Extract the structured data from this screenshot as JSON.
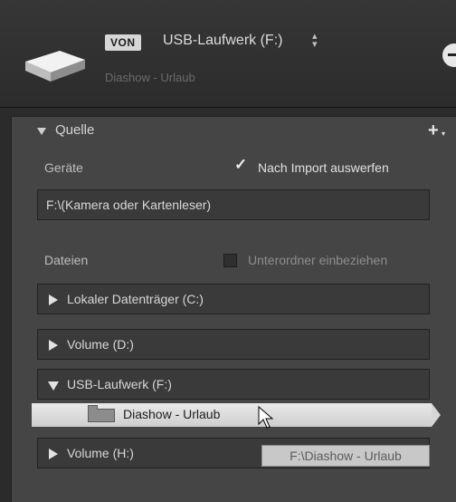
{
  "header": {
    "badge": "VON",
    "source_title": "USB-Laufwerk (F:)",
    "source_arrows": "⬍",
    "source_subtitle": "Diashow - Urlaub",
    "drive_icon": "hard-drive-icon"
  },
  "panel": {
    "title": "Quelle",
    "add_button": "+",
    "add_caret": "▾",
    "devices_label": "Geräte",
    "eject_checkbox": {
      "label": "Nach Import auswerfen",
      "checked": true,
      "mark": "✓"
    },
    "device_field": "F:\\(Kamera oder Kartenleser)",
    "files_label": "Dateien",
    "subfolders_checkbox": {
      "label": "Unterordner einbeziehen",
      "checked": false
    }
  },
  "drives": [
    {
      "label": "Lokaler Datenträger (C:)",
      "expanded": false
    },
    {
      "label": "Volume (D:)",
      "expanded": false
    },
    {
      "label": "USB-Laufwerk (F:)",
      "expanded": true
    },
    {
      "label": "Volume (H:)",
      "expanded": false
    }
  ],
  "selected_folder": {
    "label": "Diashow - Urlaub",
    "icon": "folder-icon"
  },
  "tooltip": "F:\\Diashow - Urlaub",
  "colors": {
    "background": "#2b2b2b",
    "panel": "#454545",
    "row": "#3a3a3a",
    "selected": "#e0e0e0",
    "text": "#d7d7d7"
  }
}
